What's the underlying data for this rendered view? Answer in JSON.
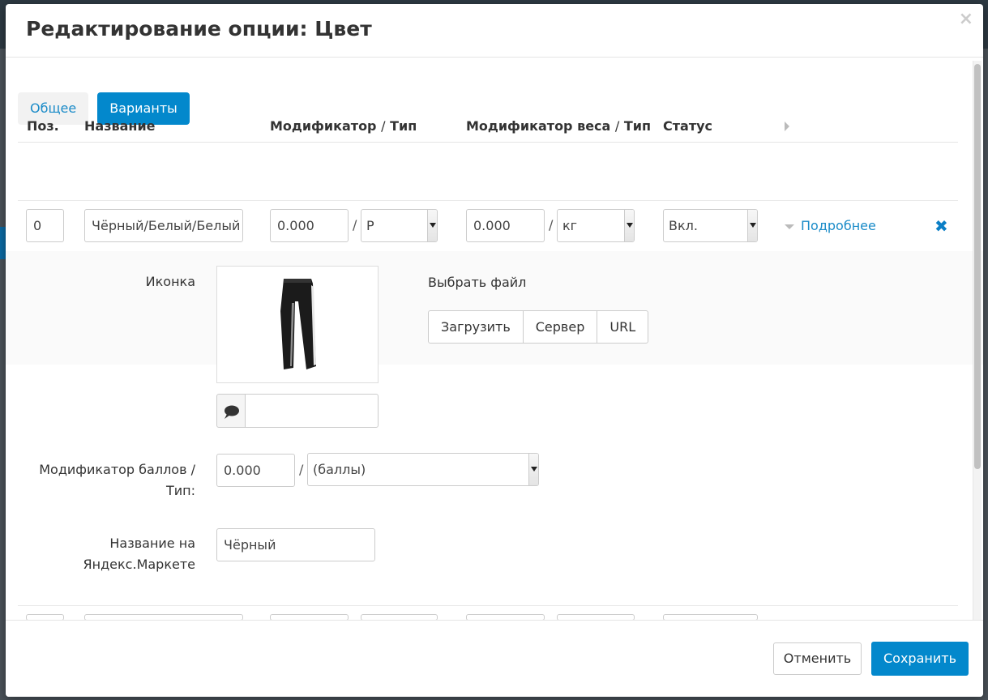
{
  "modal": {
    "title": "Редактирование опции: Цвет",
    "close_icon": "close-icon"
  },
  "tabs": [
    {
      "label": "Общее",
      "active": false
    },
    {
      "label": "Варианты",
      "active": true
    }
  ],
  "table": {
    "headers": {
      "pos": "Поз.",
      "name": "Название",
      "modifier": "Модификатор",
      "type": "Тип",
      "weight_modifier": "Модификатор веса",
      "weight_type": "Тип",
      "status": "Статус",
      "separator": "/"
    },
    "row1": {
      "pos": "0",
      "name": "Чёрный/Белый/Белый",
      "modifier": "0.000",
      "modifier_type": "Р",
      "weight": "0.000",
      "weight_unit": "кг",
      "status": "Вкл.",
      "more_link": "Подробнее",
      "delete_icon": "close-icon"
    }
  },
  "details": {
    "icon_label": "Иконка",
    "icon_image": "product-pants-image",
    "alt_icon": "speech-bubble-icon",
    "choose_file": "Выбрать файл",
    "upload_buttons": [
      "Загрузить",
      "Сервер",
      "URL"
    ],
    "points_label_1": "Модификатор баллов /",
    "points_label_2": "Тип:",
    "points_value": "0.000",
    "points_type": "(баллы)",
    "yandex_label_1": "Название на",
    "yandex_label_2": "Яндекс.Маркете",
    "yandex_value": "Чёрный"
  },
  "footer": {
    "cancel": "Отменить",
    "save": "Сохранить"
  },
  "colors": {
    "primary": "#0388cc",
    "link": "#1a8bc8"
  }
}
